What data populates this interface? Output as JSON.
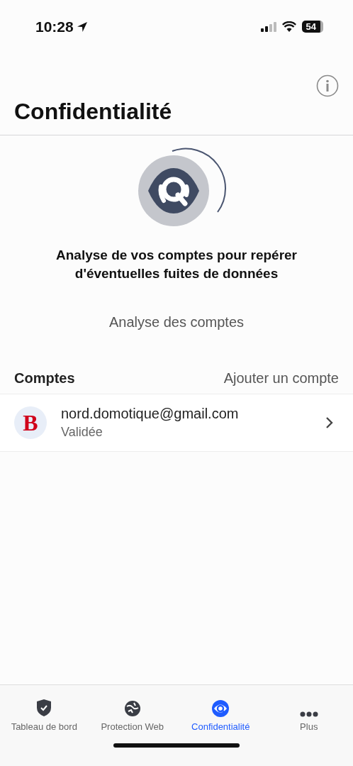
{
  "status_bar": {
    "time": "10:28",
    "battery": "54"
  },
  "header": {
    "title": "Confidentialité"
  },
  "hero": {
    "heading": "Analyse de vos comptes pour repérer d'éventuelles fuites de données",
    "action": "Analyse des comptes"
  },
  "accounts": {
    "label": "Comptes",
    "add": "Ajouter un compte",
    "items": [
      {
        "logo_letter": "B",
        "email": "nord.domotique@gmail.com",
        "status": "Validée"
      }
    ]
  },
  "tabs": [
    {
      "kind": "shield",
      "label": "Tableau de bord",
      "selected": false
    },
    {
      "kind": "globe",
      "label": "Protection Web",
      "selected": false
    },
    {
      "kind": "eye",
      "label": "Confidentialité",
      "selected": true
    },
    {
      "kind": "more",
      "label": "Plus",
      "selected": false
    }
  ]
}
